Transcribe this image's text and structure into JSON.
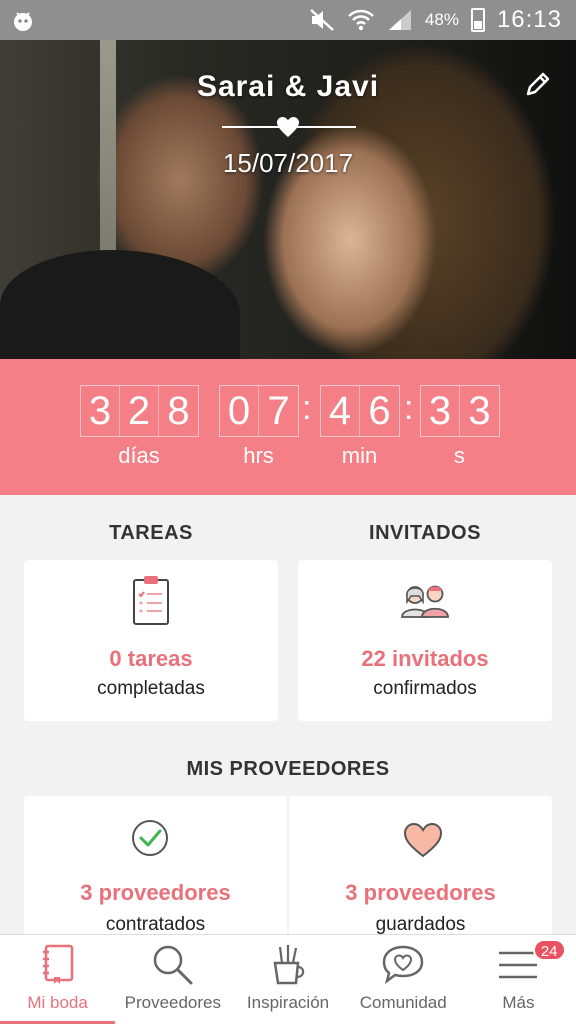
{
  "status_bar": {
    "battery": "48%",
    "time": "16:13"
  },
  "hero": {
    "title": "Sarai & Javi",
    "date": "15/07/2017"
  },
  "countdown": {
    "days": [
      "3",
      "2",
      "8"
    ],
    "hours": [
      "0",
      "7"
    ],
    "minutes": [
      "4",
      "6"
    ],
    "seconds": [
      "3",
      "3"
    ],
    "labels": {
      "days": "días",
      "hours": "hrs",
      "minutes": "min",
      "seconds": "s"
    }
  },
  "tasks": {
    "title": "TAREAS",
    "count": "0 tareas",
    "caption": "completadas"
  },
  "guests": {
    "title": "INVITADOS",
    "count": "22 invitados",
    "caption": "confirmados"
  },
  "vendors": {
    "title": "MIS PROVEEDORES",
    "hired": {
      "count": "3 proveedores",
      "caption": "contratados"
    },
    "saved": {
      "count": "3 proveedores",
      "caption": "guardados"
    }
  },
  "nav": {
    "items": [
      {
        "label": "Mi boda",
        "icon": "notebook-icon"
      },
      {
        "label": "Proveedores",
        "icon": "search-icon"
      },
      {
        "label": "Inspiración",
        "icon": "pencil-cup-icon"
      },
      {
        "label": "Comunidad",
        "icon": "chat-heart-icon"
      },
      {
        "label": "Más",
        "icon": "menu-icon",
        "badge": "24"
      }
    ]
  },
  "colors": {
    "accent": "#e8717b",
    "countdown_bg": "#f47f86"
  }
}
